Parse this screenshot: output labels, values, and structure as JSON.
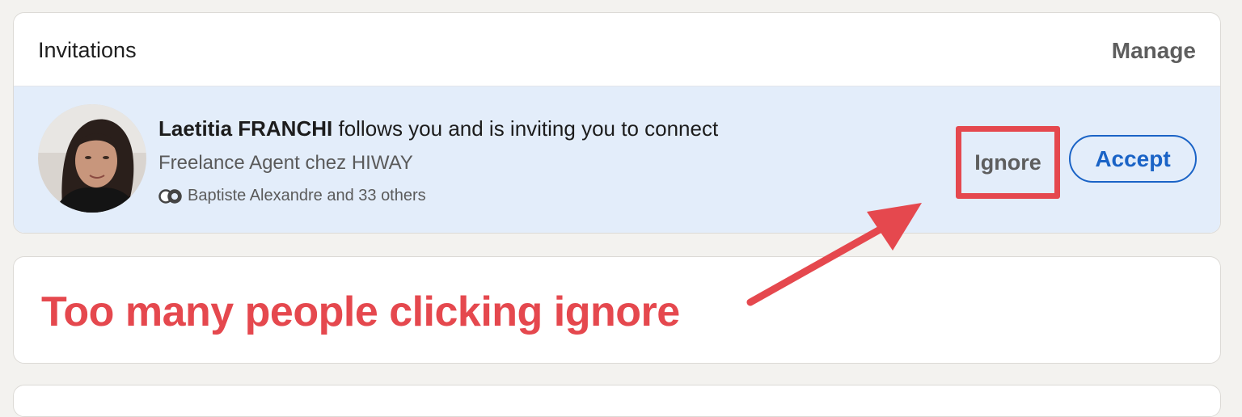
{
  "invitations_card": {
    "title": "Invitations",
    "manage_label": "Manage"
  },
  "invitation": {
    "name": "Laetitia FRANCHI",
    "message": " follows you and is inviting you to connect",
    "subtitle": "Freelance Agent chez HIWAY",
    "mutual": "Baptiste Alexandre and 33 others",
    "ignore_label": "Ignore",
    "accept_label": "Accept"
  },
  "annotation": {
    "text": "Too many people clicking ignore",
    "color": "#e5484e"
  },
  "icons": [
    "avatar-photo",
    "mutual-connections-icon",
    "annotation-arrow"
  ],
  "colors": {
    "accent_blue": "#1a63c6",
    "row_highlight": "#e3edfa",
    "page_background": "#f3f2ef"
  }
}
